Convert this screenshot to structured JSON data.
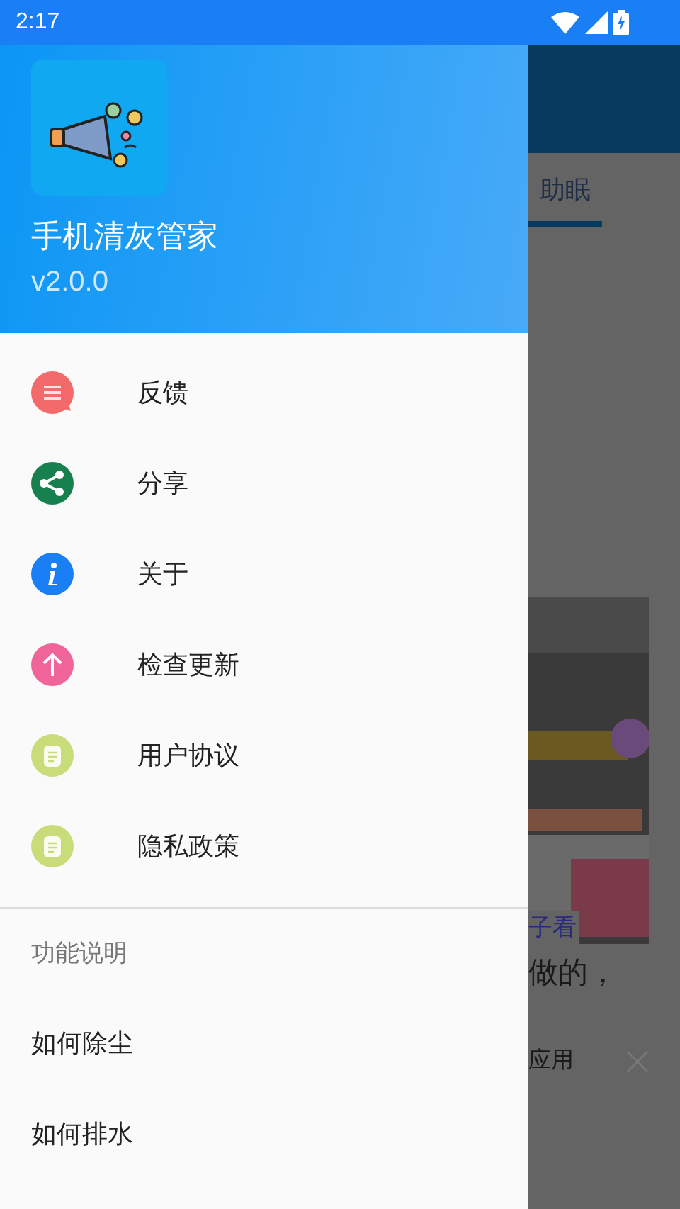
{
  "status_bar": {
    "time": "2:17"
  },
  "drawer": {
    "app_name": "手机清灰管家",
    "version": "v2.0.0",
    "menu": [
      {
        "label": "反馈",
        "kind": "feedback",
        "color": "#f26a6a"
      },
      {
        "label": "分享",
        "kind": "share",
        "color": "#17804f"
      },
      {
        "label": "关于",
        "kind": "info",
        "color": "#1a7ef5"
      },
      {
        "label": "检查更新",
        "kind": "update",
        "color": "#f0649a"
      },
      {
        "label": "用户协议",
        "kind": "document",
        "color": "#c9dc7a"
      },
      {
        "label": "隐私政策",
        "kind": "document",
        "color": "#c9dc7a"
      }
    ],
    "section": {
      "title": "功能说明",
      "items": [
        {
          "label": "如何除尘"
        },
        {
          "label": "如何排水"
        }
      ]
    }
  },
  "background": {
    "tab": {
      "label": "助眠",
      "selected": true
    },
    "caption": "子看",
    "text": "做的，",
    "bottom_text": "应用"
  }
}
